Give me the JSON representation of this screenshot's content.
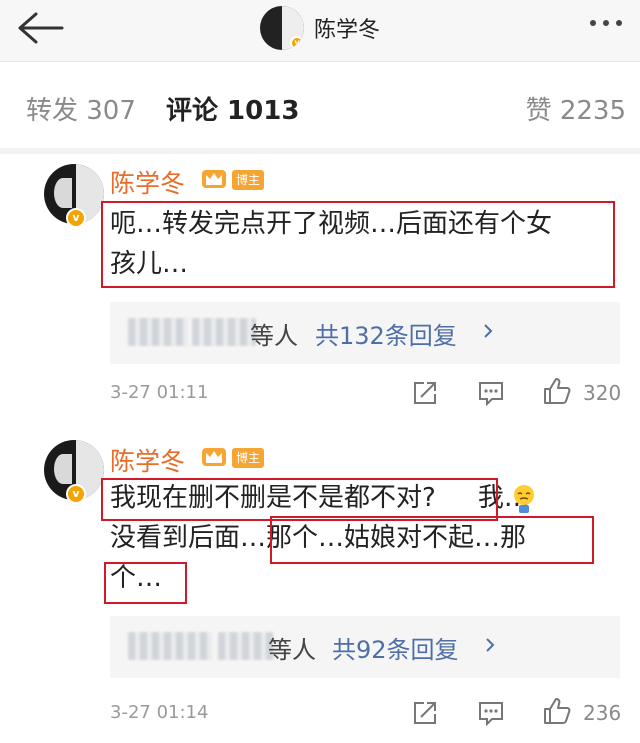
{
  "header": {
    "title": "陈学冬"
  },
  "tabs": {
    "repost": "转发 307",
    "comments": "评论 1013",
    "likes": "赞 2235"
  },
  "comments": [
    {
      "name": "陈学冬",
      "host_tag": "博主",
      "text_line1": "呃…转发完点开了视频…后面还有个女",
      "text_line2": "孩儿…",
      "reply_etc": "等人",
      "reply_count": "共132条回复",
      "time": "3-27 01:11",
      "likes": "320"
    },
    {
      "name": "陈学冬",
      "host_tag": "博主",
      "text_seg1": "我现在删不删是不是都不对?",
      "text_seg2": "我…",
      "text_seg3": "没看到后面",
      "text_seg4": "…那个…姑娘对不起…那",
      "text_seg5": "个…",
      "reply_etc": "等人",
      "reply_count": "共92条回复",
      "time": "3-27 01:14",
      "likes": "236"
    }
  ],
  "colors": {
    "name": "#e96d29",
    "highlight_box": "#d01a2a",
    "link": "#4e6ea8",
    "badge": "#f4a300"
  }
}
